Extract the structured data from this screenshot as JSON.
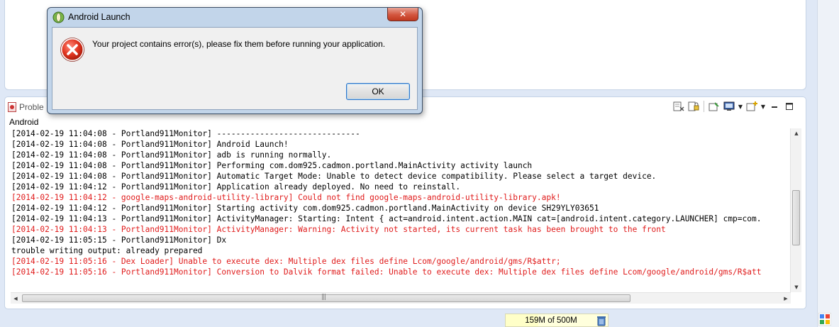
{
  "dialog": {
    "title": "Android Launch",
    "message": "Your project contains error(s), please fix them before running your application.",
    "ok_label": "OK",
    "close_label": "✕"
  },
  "view": {
    "problems_tab": "Proble",
    "console_name": "Android",
    "lines": [
      {
        "text": "[2014-02-19 11:04:08 - Portland911Monitor] ------------------------------",
        "error": false
      },
      {
        "text": "[2014-02-19 11:04:08 - Portland911Monitor] Android Launch!",
        "error": false
      },
      {
        "text": "[2014-02-19 11:04:08 - Portland911Monitor] adb is running normally.",
        "error": false
      },
      {
        "text": "[2014-02-19 11:04:08 - Portland911Monitor] Performing com.dom925.cadmon.portland.MainActivity activity launch",
        "error": false
      },
      {
        "text": "[2014-02-19 11:04:08 - Portland911Monitor] Automatic Target Mode: Unable to detect device compatibility. Please select a target device.",
        "error": false
      },
      {
        "text": "[2014-02-19 11:04:12 - Portland911Monitor] Application already deployed. No need to reinstall.",
        "error": false
      },
      {
        "text": "[2014-02-19 11:04:12 - google-maps-android-utility-library] Could not find google-maps-android-utility-library.apk!",
        "error": true
      },
      {
        "text": "[2014-02-19 11:04:12 - Portland911Monitor] Starting activity com.dom925.cadmon.portland.MainActivity on device SH29YLY03651",
        "error": false
      },
      {
        "text": "[2014-02-19 11:04:13 - Portland911Monitor] ActivityManager: Starting: Intent { act=android.intent.action.MAIN cat=[android.intent.category.LAUNCHER] cmp=com.",
        "error": false
      },
      {
        "text": "[2014-02-19 11:04:13 - Portland911Monitor] ActivityManager: Warning: Activity not started, its current task has been brought to the front",
        "error": true
      },
      {
        "text": "[2014-02-19 11:05:15 - Portland911Monitor] Dx",
        "error": false
      },
      {
        "text": "trouble writing output: already prepared",
        "error": false
      },
      {
        "text": "[2014-02-19 11:05:16 - Dex Loader] Unable to execute dex: Multiple dex files define Lcom/google/android/gms/R$attr;",
        "error": true
      },
      {
        "text": "[2014-02-19 11:05:16 - Portland911Monitor] Conversion to Dalvik format failed: Unable to execute dex: Multiple dex files define Lcom/google/android/gms/R$att",
        "error": true
      }
    ]
  },
  "status": {
    "heap_label": "159M of 500M",
    "heap_used_fraction": 0.318
  },
  "colors": {
    "error_text": "#e01b1b",
    "normal_text": "#000000"
  }
}
